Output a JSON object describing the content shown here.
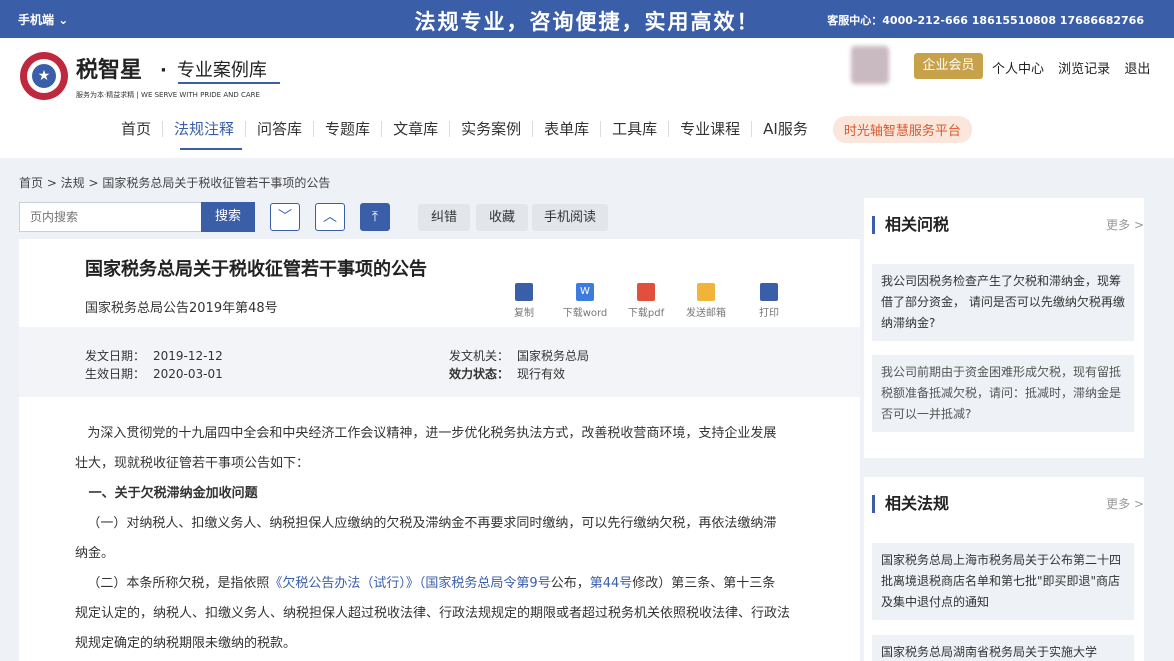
{
  "topbar": {
    "mobile": "手机端",
    "slogan": "法规专业，咨询便捷，实用高效！",
    "service": "客服中心：4000-212-666  18615510808  17686682766"
  },
  "brand": {
    "name": "税智星",
    "sub": "专业案例库",
    "tagline": "服务为本·精益求精 | WE SERVE WITH PRIDE AND CARE"
  },
  "user": {
    "vip": "企业会员",
    "links": [
      "个人中心",
      "浏览记录",
      "退出"
    ]
  },
  "nav": {
    "items": [
      "首页",
      "法规注释",
      "问答库",
      "专题库",
      "文章库",
      "实务案例",
      "表单库",
      "工具库",
      "专业课程",
      "AI服务"
    ],
    "active": "法规注释",
    "platform": "时光轴智慧服务平台"
  },
  "breadcrumb": "首页 > 法规 > 国家税务总局关于税收征管若干事项的公告",
  "toolbar": {
    "search_placeholder": "页内搜索",
    "search_btn": "搜索",
    "buttons": [
      "纠错",
      "收藏",
      "手机阅读"
    ]
  },
  "article": {
    "title": "国家税务总局关于税收征管若干事项的公告",
    "doc_no": "国家税务总局公告2019年第48号",
    "actions": [
      {
        "label": "复制",
        "icon": "copy-icon",
        "color": "#3a5ea8"
      },
      {
        "label": "下载word",
        "icon": "word-icon",
        "color": "#3d7be0"
      },
      {
        "label": "下载pdf",
        "icon": "pdf-icon",
        "color": "#e0503d"
      },
      {
        "label": "发送邮箱",
        "icon": "mail-icon",
        "color": "#f0b43a"
      },
      {
        "label": "打印",
        "icon": "print-icon",
        "color": "#3a5ea8"
      }
    ],
    "meta": {
      "issue_date_label": "发文日期：",
      "issue_date": "2019-12-12",
      "effective_label": "生效日期：",
      "effective_date": "2020-03-01",
      "org_label": "发文机关：",
      "org": "国家税务总局",
      "status_label": "效力状态：",
      "status": "现行有效"
    },
    "p1a": "为深入贯彻党的十九届四中全会和中央经济工作会议精神，进一步优化税务执法方式，改善税收营商环境，支持企业发展",
    "p1b": "壮大，现就税收征管若干事项公告如下：",
    "h1": "一、关于欠税滞纳金加收问题",
    "p2a": "（一）对纳税人、扣缴义务人、纳税担保人应缴纳的欠税及滞纳金不再要求同时缴纳，可以先行缴纳欠税，再依法缴纳滞",
    "p2b": "纳金。",
    "p3_pre": "（二）本条所称欠税，是指依照",
    "p3_link1": "《欠税公告办法（试行）》（国家税务总局令第9号",
    "p3_mid": "公布，",
    "p3_link2": "第44号",
    "p3_post": "修改）第三条、第十三条",
    "p3b": "规定认定的，纳税人、扣缴义务人、纳税担保人超过税收法律、行政法规规定的期限或者超过税务机关依照税收法律、行政法",
    "p3c": "规规定确定的纳税期限未缴纳的税款。"
  },
  "sidebar": {
    "qa_title": "相关问税",
    "qa_more": "更多 >",
    "qa": [
      "我公司因税务检查产生了欠税和滞纳金，现筹借了部分资金， 请问是否可以先缴纳欠税再缴纳滞纳金?",
      "我公司前期由于资金困难形成欠税，现有留抵税额准备抵减欠税，请问：抵减时，滞纳金是否可以一并抵减?"
    ],
    "law_title": "相关法规",
    "law_more": "更多 >",
    "laws": [
      "国家税务总局上海市税务局关于公布第二十四批离境退税商店名单和第七批\"即买即退\"商店及集中退付点的通知",
      "国家税务总局湖南省税务局关于实施大学"
    ]
  }
}
